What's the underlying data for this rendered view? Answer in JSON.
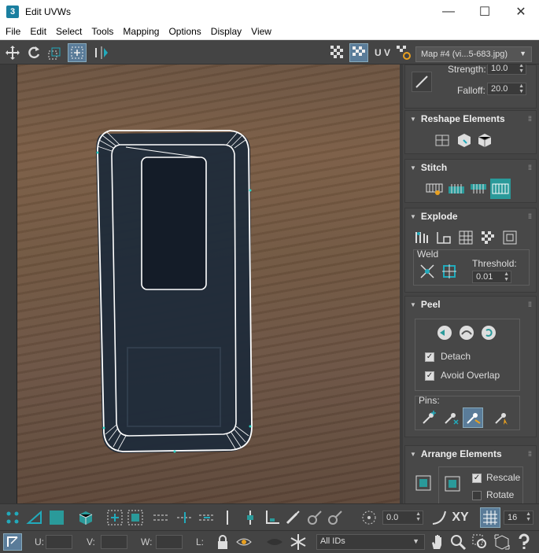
{
  "window": {
    "title": "Edit UVWs",
    "app_icon": "3",
    "minimize": "—",
    "maximize": "☐",
    "close": "✕"
  },
  "menu": [
    "File",
    "Edit",
    "Select",
    "Tools",
    "Mapping",
    "Options",
    "Display",
    "View"
  ],
  "toolbar": {
    "uv_label": "U V",
    "map_select": "Map #4 (vi...5-683.jpg)"
  },
  "panel": {
    "top": {
      "strength_label": "Strength:",
      "strength_value": "10.0",
      "falloff_label": "Falloff:",
      "falloff_value": "20.0"
    },
    "reshape": {
      "title": "Reshape Elements"
    },
    "stitch": {
      "title": "Stitch"
    },
    "explode": {
      "title": "Explode",
      "weld_label": "Weld",
      "threshold_label": "Threshold:",
      "threshold_value": "0.01"
    },
    "peel": {
      "title": "Peel",
      "detach_label": "Detach",
      "detach_checked": true,
      "avoid_overlap_label": "Avoid Overlap",
      "avoid_overlap_checked": true,
      "pins_label": "Pins:"
    },
    "arrange": {
      "title": "Arrange Elements",
      "rescale_label": "Rescale",
      "rescale_checked": true,
      "rotate_label": "Rotate",
      "rotate_checked": false
    }
  },
  "bottom": {
    "soft_value": "0.0",
    "xy_label": "XY",
    "grid_value": "16",
    "u_label": "U:",
    "v_label": "V:",
    "w_label": "W:",
    "l_label": "L:",
    "ids_select": "All IDs"
  },
  "colors": {
    "accent_teal": "#2a9a9a",
    "active_blue": "#5a7c99",
    "panel_bg": "#444444"
  }
}
